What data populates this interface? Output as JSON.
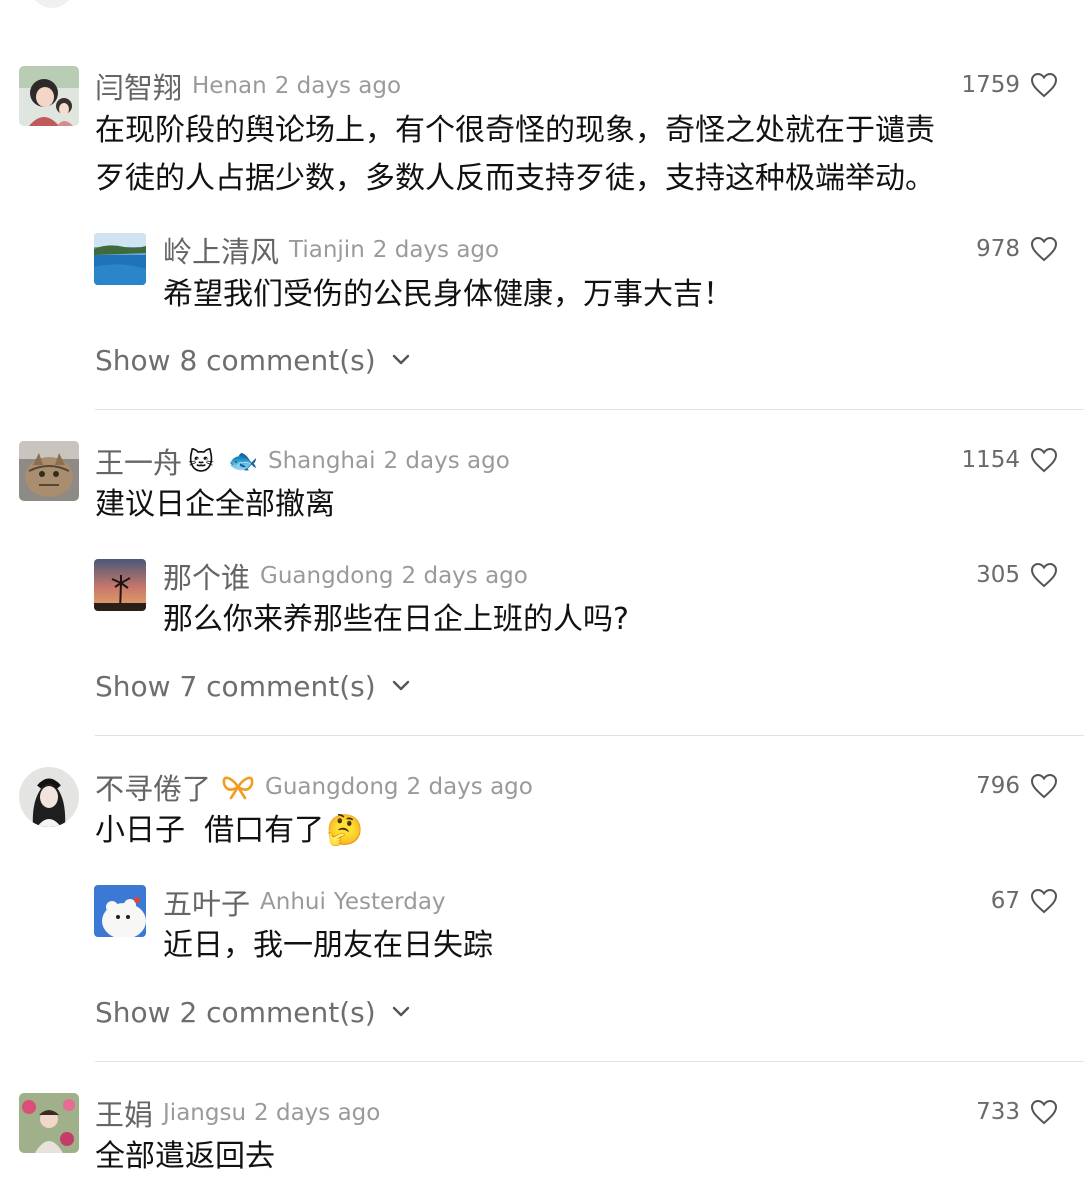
{
  "threads": [
    {
      "comment": {
        "username": "闫智翔",
        "location": "Henan",
        "time": "2 days ago",
        "likes": "1759",
        "text_lines": [
          "在现阶段的舆论场上，有个很奇怪的现象，奇怪之处就在于谴责",
          "歹徒的人占据少数，多数人反而支持歹徒，支持这种极端举动。"
        ]
      },
      "reply": {
        "username": "岭上清风",
        "location": "Tianjin",
        "time": "2 days ago",
        "likes": "978",
        "text": "希望我们受伤的公民身体健康，万事大吉！"
      },
      "show_more": "Show 8 comment(s)"
    },
    {
      "comment": {
        "username": "王一舟",
        "badges": [
          "🐱",
          "🐟"
        ],
        "location": "Shanghai",
        "time": "2 days ago",
        "likes": "1154",
        "text_lines": [
          "建议日企全部撤离"
        ]
      },
      "reply": {
        "username": "那个谁",
        "location": "Guangdong",
        "time": "2 days ago",
        "likes": "305",
        "text": "那么你来养那些在日企上班的人吗?"
      },
      "show_more": "Show 7 comment(s)"
    },
    {
      "comment": {
        "username": "不寻倦了",
        "badges": [
          "ribbon-badge-icon"
        ],
        "location": "Guangdong",
        "time": "2 days ago",
        "likes": "796",
        "text": "小日子  借口有了",
        "emoji": "🤔"
      },
      "reply": {
        "username": "五叶子",
        "location": "Anhui",
        "time": "Yesterday",
        "likes": "67",
        "text": "近日，我一朋友在日失踪"
      },
      "show_more": "Show 2 comment(s)"
    },
    {
      "comment": {
        "username": "王娟",
        "location": "Jiangsu",
        "time": "2 days ago",
        "likes": "733",
        "text_lines": [
          "全部遣返回去"
        ]
      }
    }
  ],
  "icons": {
    "like": "heart-outline-icon",
    "expand": "chevron-down-icon"
  },
  "colors": {
    "username": "#656565",
    "meta": "#9a9a9a",
    "body_text": "#111111",
    "divider": "#e3e3e3",
    "badge_orange": "#f39c24"
  }
}
